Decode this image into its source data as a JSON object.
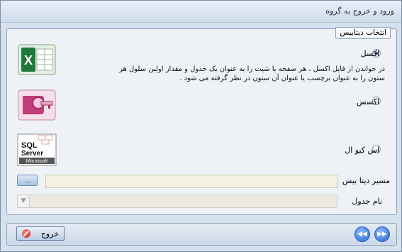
{
  "window": {
    "title": "ورود و خروج به گروه"
  },
  "group": {
    "legend": "انتخاب دیتابیس",
    "options": [
      {
        "label": "اکسل",
        "checked": true,
        "icon": "excel-logo-icon"
      },
      {
        "label": "اکسس",
        "checked": false,
        "icon": "access-logo-icon"
      },
      {
        "label": "اس کیو ال",
        "checked": false,
        "icon": "sql-server-logo-icon"
      }
    ],
    "excel_description_line1": "در خواندن از فایل اکسل ، هر صفحه یا شیت را به عنوان یک جدول و  مقدار اولین سلول هر",
    "excel_description_line2": "ستون را به عنوان برچسب یا عنوان آن ستون در نظر گرفته می شود ."
  },
  "fields": {
    "db_path_label": "مسیر دیتا بیس",
    "db_path_value": "",
    "browse_label": "...",
    "table_name_label": "نام جدول",
    "table_name_value": ""
  },
  "logos": {
    "sql_line1": "SQL",
    "sql_line2": "Server",
    "sql_line3": "Microsoft"
  },
  "footer": {
    "exit_label": "خروج",
    "prev_label": "◀◀",
    "next_label": "▶▶"
  },
  "colors": {
    "excel": "#1f7a3a",
    "access": "#b0306a",
    "accent": "#1f5fd1",
    "field_bg": "#f4f2e0"
  }
}
